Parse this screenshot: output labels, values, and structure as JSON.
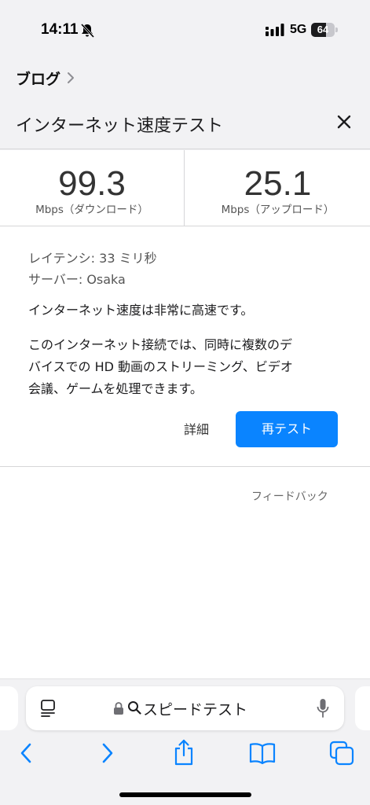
{
  "status_bar": {
    "time": "14:11",
    "network": "5G",
    "battery": "64",
    "battery_level": 0.64,
    "icons": [
      "bell-off-icon",
      "signal-icon",
      "battery-icon"
    ]
  },
  "breadcrumb": {
    "label": "ブログ"
  },
  "header": {
    "title": "インターネット速度テスト"
  },
  "speed": {
    "download": {
      "value": "99.3",
      "unit": "Mbps（ダウンロード）"
    },
    "upload": {
      "value": "25.1",
      "unit": "Mbps（アップロード）"
    }
  },
  "info": {
    "latency": "レイテンシ: 33 ミリ秒",
    "server": "サーバー: Osaka"
  },
  "summary": "インターネット速度は非常に高速です。",
  "description_lines": [
    "このインターネット接続では、同時に複数のデ",
    "バイスでの HD 動画のストリーミング、ビデオ",
    "会議、ゲームを処理できます。"
  ],
  "actions": {
    "details": "詳細",
    "retest": "再テスト"
  },
  "feedback": "フィードバック",
  "address_bar": {
    "text": "スピードテスト"
  },
  "colors": {
    "accent": "#0a84ff",
    "background": "#f2f2f4"
  }
}
